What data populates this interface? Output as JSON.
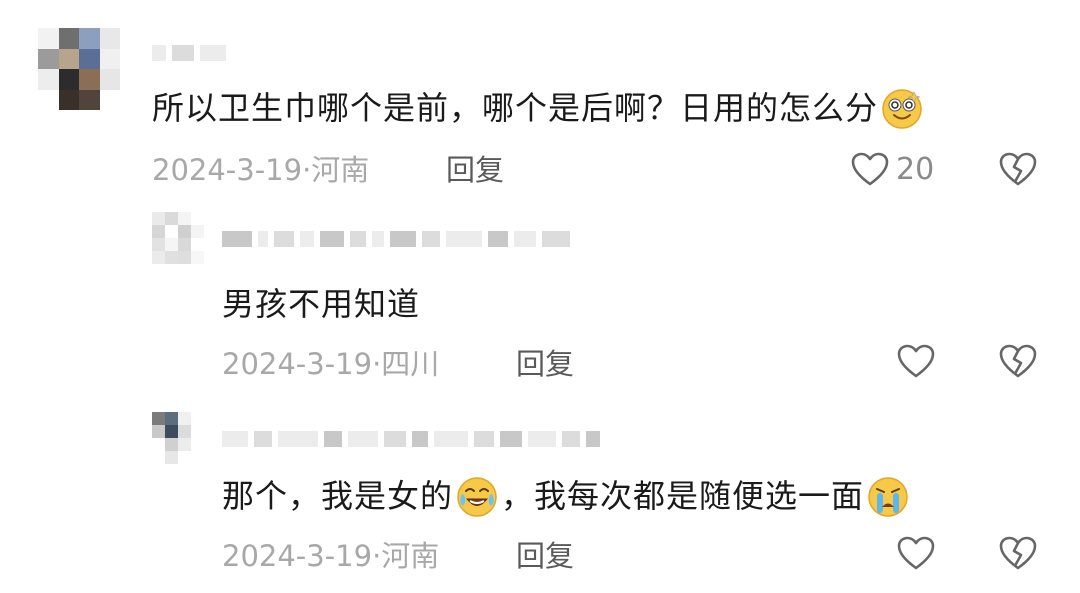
{
  "comments": [
    {
      "text_before": "所以卫生巾哪个是前，哪个是后啊？日用的怎么分",
      "emoji_mid": "",
      "text_after": "",
      "emoji_end": "dizzy-smile-emoji",
      "date_location": "2024-3-19·河南",
      "reply_label": "回复",
      "like_count": "20"
    },
    {
      "text_before": "男孩不用知道",
      "date_location": "2024-3-19·四川",
      "reply_label": "回复",
      "like_count": ""
    },
    {
      "text_before": "那个，我是女的",
      "emoji_mid": "laughing-crying-emoji",
      "text_after": "，我每次都是随便选一面",
      "emoji_end": "crying-emoji",
      "date_location": "2024-3-19·河南",
      "reply_label": "回复",
      "like_count": ""
    }
  ],
  "icons": {
    "like": "heart-outline-icon",
    "dislike": "broken-heart-icon"
  },
  "colors": {
    "text": "#1a1a1a",
    "meta": "#a8a8a8",
    "reply": "#5a5a5a",
    "icon": "#666666"
  }
}
